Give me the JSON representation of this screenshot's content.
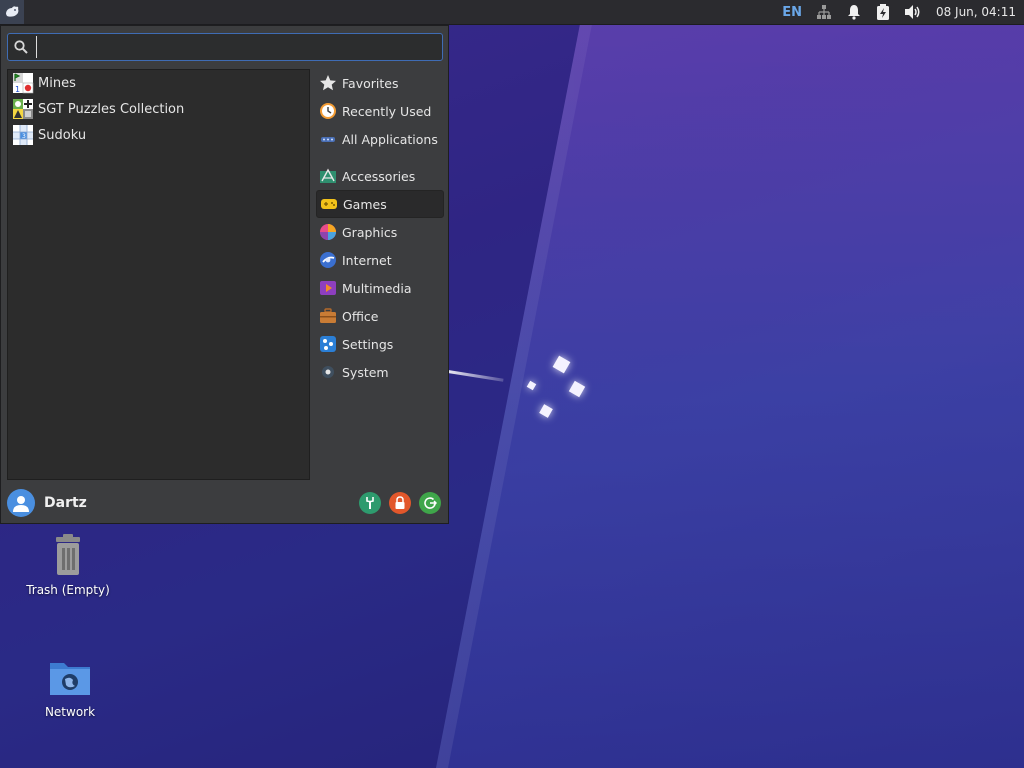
{
  "panel": {
    "keyboard_layout": "EN",
    "clock": "08 Jun, 04:11"
  },
  "menu": {
    "search": {
      "value": "",
      "placeholder": ""
    },
    "apps": [
      {
        "label": "Mines",
        "icon": "mines-icon"
      },
      {
        "label": "SGT Puzzles Collection",
        "icon": "puzzles-icon"
      },
      {
        "label": "Sudoku",
        "icon": "sudoku-icon"
      }
    ],
    "categories_top": [
      {
        "label": "Favorites",
        "icon": "star-icon"
      },
      {
        "label": "Recently Used",
        "icon": "clock-icon"
      },
      {
        "label": "All Applications",
        "icon": "apps-icon"
      }
    ],
    "categories": [
      {
        "label": "Accessories",
        "icon": "accessories-icon"
      },
      {
        "label": "Games",
        "icon": "gamepad-icon",
        "selected": true
      },
      {
        "label": "Graphics",
        "icon": "graphics-icon"
      },
      {
        "label": "Internet",
        "icon": "globe-icon"
      },
      {
        "label": "Multimedia",
        "icon": "multimedia-icon"
      },
      {
        "label": "Office",
        "icon": "briefcase-icon"
      },
      {
        "label": "Settings",
        "icon": "settings-icon"
      },
      {
        "label": "System",
        "icon": "system-icon"
      }
    ],
    "user": {
      "name": "Dartz"
    },
    "footer_actions": [
      "settings-manager-icon",
      "lock-icon",
      "logout-icon"
    ]
  },
  "desktop": {
    "icons": [
      {
        "label": "Trash (Empty)",
        "icon": "trash-icon"
      },
      {
        "label": "Network",
        "icon": "network-folder-icon"
      }
    ]
  },
  "colors": {
    "accent": "#3f6cb4",
    "panel_bg": "#2b2b2f",
    "menu_bg": "#3c3d3f",
    "list_bg": "#2c2c2c",
    "keyboard_layout": "#6aa7e8"
  }
}
